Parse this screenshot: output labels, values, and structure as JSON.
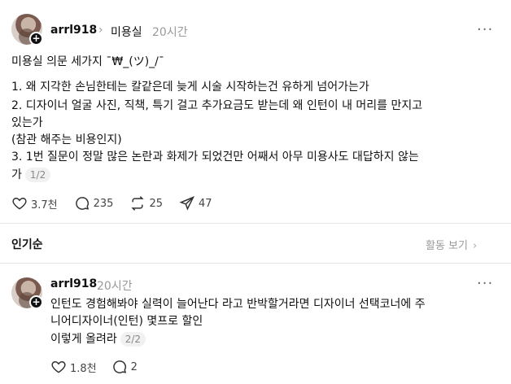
{
  "post": {
    "username": "arrl918",
    "community": "미용실",
    "time": "20시간",
    "title": "미용실 의문 세가지 ¯₩_(ツ)_/¯",
    "lines": [
      "1. 왜 지각한 손님한테는 칼같은데 늦게 시술 시작하는건 유하게 넘어가는가",
      "2. 디자이너 얼굴 사진, 직책, 특기 걸고 추가요금도 받는데 왜 인턴이 내 머리를 만지고",
      "있는가",
      "(참관 해주는 비용인지)",
      "3. 1번 질문이 정말 많은 논란과 화제가 되었건만 어째서 아무 미용사도 대답하지 않는",
      "가"
    ],
    "page": "1/2",
    "likes": "3.7천",
    "comments": "235",
    "reposts": "25",
    "shares": "47"
  },
  "sort": {
    "label": "인기순",
    "activity": "활동 보기"
  },
  "reply": {
    "username": "arrl918",
    "time": "20시간",
    "lines": [
      "인턴도 경험해봐야 실력이 늘어난다 라고 반박할거라면 디자이너 선택코너에 주",
      "니어디자이너(인턴) 몇프로 할인",
      "이렇게 올려라"
    ],
    "page": "2/2",
    "likes": "1.8천",
    "comments": "2"
  }
}
